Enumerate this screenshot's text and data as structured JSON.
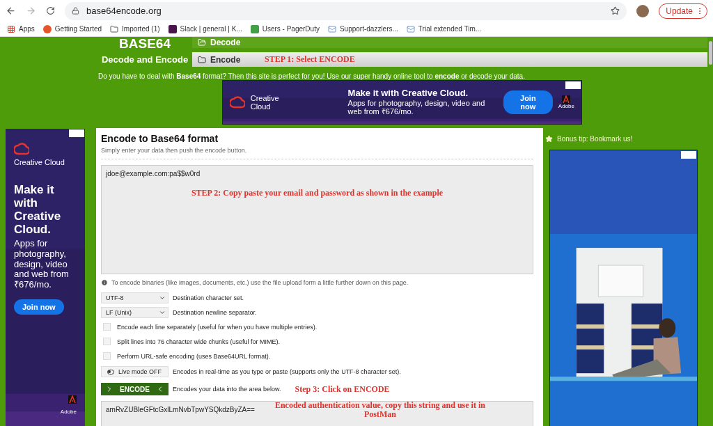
{
  "browser": {
    "url": "base64encode.org",
    "update_button": "Update",
    "bookmarks": [
      {
        "label": "Apps",
        "kind": "grid"
      },
      {
        "label": "Getting Started",
        "kind": "ring"
      },
      {
        "label": "Imported (1)",
        "kind": "folder"
      },
      {
        "label": "Slack | general | K...",
        "kind": "slack"
      },
      {
        "label": "Users - PagerDuty",
        "kind": "pager"
      },
      {
        "label": "Support-dazzlers...",
        "kind": "mail"
      },
      {
        "label": "Trial extended Tim...",
        "kind": "mail"
      }
    ]
  },
  "header": {
    "logo_title": "BASE64",
    "logo_subtitle": "Decode and Encode",
    "nav": [
      {
        "label": "Decode",
        "selected": false
      },
      {
        "label": "Encode",
        "selected": true
      }
    ],
    "step1": "STEP 1: Select ENCODE"
  },
  "intro": "Do you have to deal with **Base64** format? Then this site is perfect for you! Use our super handy online tool to **encode** or decode your data.",
  "top_ad": {
    "brand": "Creative Cloud",
    "headline": "Make it with Creative Cloud.",
    "body": "Apps for photography, design, video and web from ₹676/mo.",
    "button": "Join now",
    "maker": "Adobe"
  },
  "left_ad": {
    "brand": "Creative Cloud",
    "headline": "Make it with Creative Cloud.",
    "body": "Apps for photography, design, video and web from ₹676/mo.",
    "button": "Join now",
    "maker": "Adobe"
  },
  "main": {
    "title": "Encode to Base64 format",
    "subtitle": "Simply enter your data then push the encode button.",
    "input_value": "jdoe@example.com:pa$$w0rd",
    "step2": "STEP 2: Copy paste your email and password as shown in the example",
    "note": "To encode binaries (like images, documents, etc.) use the file upload form a little further down on this page.",
    "selects": [
      {
        "value": "UTF-8",
        "label": "Destination character set."
      },
      {
        "value": "LF (Unix)",
        "label": "Destination newline separator."
      }
    ],
    "options": [
      {
        "label": "Encode each line separately (useful for when you have multiple entries).",
        "checked": false
      },
      {
        "label": "Split lines into 76 character wide chunks (useful for MIME).",
        "checked": false
      },
      {
        "label": "Perform URL-safe encoding (uses Base64URL format).",
        "checked": false
      }
    ],
    "live_mode": {
      "label": "Live mode OFF",
      "on": false,
      "description": "Encodes in real-time as you type or paste (supports only the UTF-8 character set)."
    },
    "encode_button": "ENCODE",
    "encode_description": "Encodes your data into the area below.",
    "step3": "Step 3: Click on ENCODE",
    "output_value": "amRvZUBleGFtcGxlLmNvbTpwYSQkdzByZA==",
    "step4": "Encoded authentication value, copy this string and use it in PostMan"
  },
  "sidebar": {
    "tip": "Bonus tip: Bookmark us!"
  }
}
